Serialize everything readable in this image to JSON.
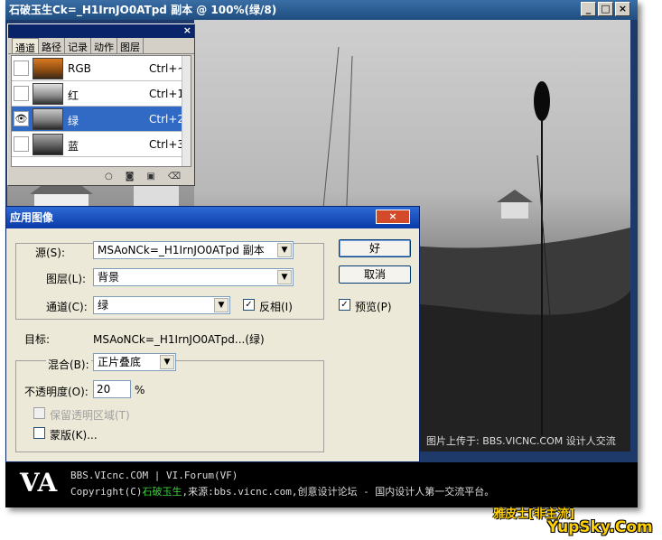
{
  "document": {
    "title": "石破玉生Ck=_H1IrnJO0ATpd 副本 @ 100%(绿/8)",
    "min": "_",
    "max": "□",
    "close": "×"
  },
  "channels_panel": {
    "close": "×",
    "tabs": [
      "通道",
      "路径",
      "记录",
      "动作",
      "图层"
    ],
    "channels": [
      {
        "name": "RGB",
        "shortcut": "Ctrl+~",
        "visible": false,
        "selected": false
      },
      {
        "name": "红",
        "shortcut": "Ctrl+1",
        "visible": false,
        "selected": false
      },
      {
        "name": "绿",
        "shortcut": "Ctrl+2",
        "visible": true,
        "selected": true
      },
      {
        "name": "蓝",
        "shortcut": "Ctrl+3",
        "visible": false,
        "selected": false
      }
    ],
    "eye_glyph": "👁"
  },
  "dialog": {
    "title": "应用图像",
    "close": "×",
    "source_label": "源(S):",
    "source_value": "MSAoNCk=_H1IrnJO0ATpd 副本",
    "layer_label": "图层(L):",
    "layer_value": "背景",
    "channel_label": "通道(C):",
    "channel_value": "绿",
    "invert_label": "反相(I)",
    "target_label": "目标:",
    "target_value": "MSAoNCk=_H1IrnJO0ATpd...(绿)",
    "blend_label": "混合(B):",
    "blend_value": "正片叠底",
    "opacity_label": "不透明度(O):",
    "opacity_value": "20",
    "opacity_unit": "%",
    "preserve_label": "保留透明区域(T)",
    "mask_label": "蒙版(K)...",
    "ok": "好",
    "cancel": "取消",
    "preview_label": "预览(P)",
    "check_glyph": "✓"
  },
  "watermark": "图片上传于: BBS.VICNC.COM 设计人交流",
  "footer": {
    "logo": "VA",
    "line1": "BBS.VIcnc.COM | VI.Forum(VF)",
    "line2_prefix": "Copyright(C)",
    "line2_name": "石破玉生",
    "line2_rest": ",来源:bbs.vicnc.com,创意设计论坛 - 国内设计人第一交流平台。"
  },
  "brand": {
    "line1": "雅皮士[非主流]",
    "line2": "YupSky.Com"
  },
  "colors": {
    "selection": "#316ac5",
    "dialog_title": "#0a3aa8",
    "footer_green": "#3cd23c",
    "brand_yellow": "#ffd000"
  }
}
